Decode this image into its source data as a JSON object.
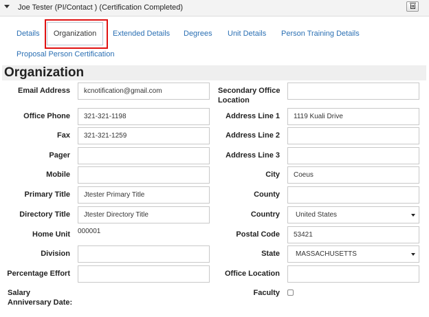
{
  "header": {
    "title": "Joe Tester (PI/Contact ) (Certification Completed)",
    "delete_icon": "trash-icon"
  },
  "tabs": [
    {
      "label": "Details"
    },
    {
      "label": "Organization",
      "active": true
    },
    {
      "label": "Extended Details"
    },
    {
      "label": "Degrees"
    },
    {
      "label": "Unit Details"
    },
    {
      "label": "Person Training Details"
    },
    {
      "label": "Proposal Person Certification"
    }
  ],
  "section": {
    "title": "Organization"
  },
  "form": {
    "email": {
      "label": "Email Address",
      "value": "kcnotification@gmail.com"
    },
    "office_phone": {
      "label": "Office Phone",
      "value": "321-321-1198"
    },
    "fax": {
      "label": "Fax",
      "value": "321-321-1259"
    },
    "pager": {
      "label": "Pager",
      "value": ""
    },
    "mobile": {
      "label": "Mobile",
      "value": ""
    },
    "primary_title": {
      "label": "Primary Title",
      "value": "Jtester Primary Title"
    },
    "directory_title": {
      "label": "Directory Title",
      "value": "Jtester Directory Title"
    },
    "home_unit": {
      "label": "Home Unit",
      "value": "000001"
    },
    "division": {
      "label": "Division",
      "value": ""
    },
    "percentage_effort": {
      "label": "Percentage Effort",
      "value": ""
    },
    "salary_anniversary": {
      "label_line1": "Salary",
      "label_line2": "Anniversary Date:"
    },
    "secondary_office": {
      "label_line1": "Secondary Office",
      "label_line2": "Location",
      "value": ""
    },
    "address1": {
      "label": "Address Line 1",
      "value": "1119 Kuali Drive"
    },
    "address2": {
      "label": "Address Line 2",
      "value": ""
    },
    "address3": {
      "label": "Address Line 3",
      "value": ""
    },
    "city": {
      "label": "City",
      "value": "Coeus"
    },
    "county": {
      "label": "County",
      "value": ""
    },
    "country": {
      "label": "Country",
      "value": "United States"
    },
    "postal_code": {
      "label": "Postal Code",
      "value": "53421"
    },
    "state": {
      "label": "State",
      "value": "MASSACHUSETTS"
    },
    "office_location": {
      "label": "Office Location",
      "value": ""
    },
    "faculty": {
      "label": "Faculty",
      "checked": false
    }
  },
  "colors": {
    "link": "#2a6fb3",
    "highlight": "#e01010",
    "section_bg": "#efefef"
  }
}
